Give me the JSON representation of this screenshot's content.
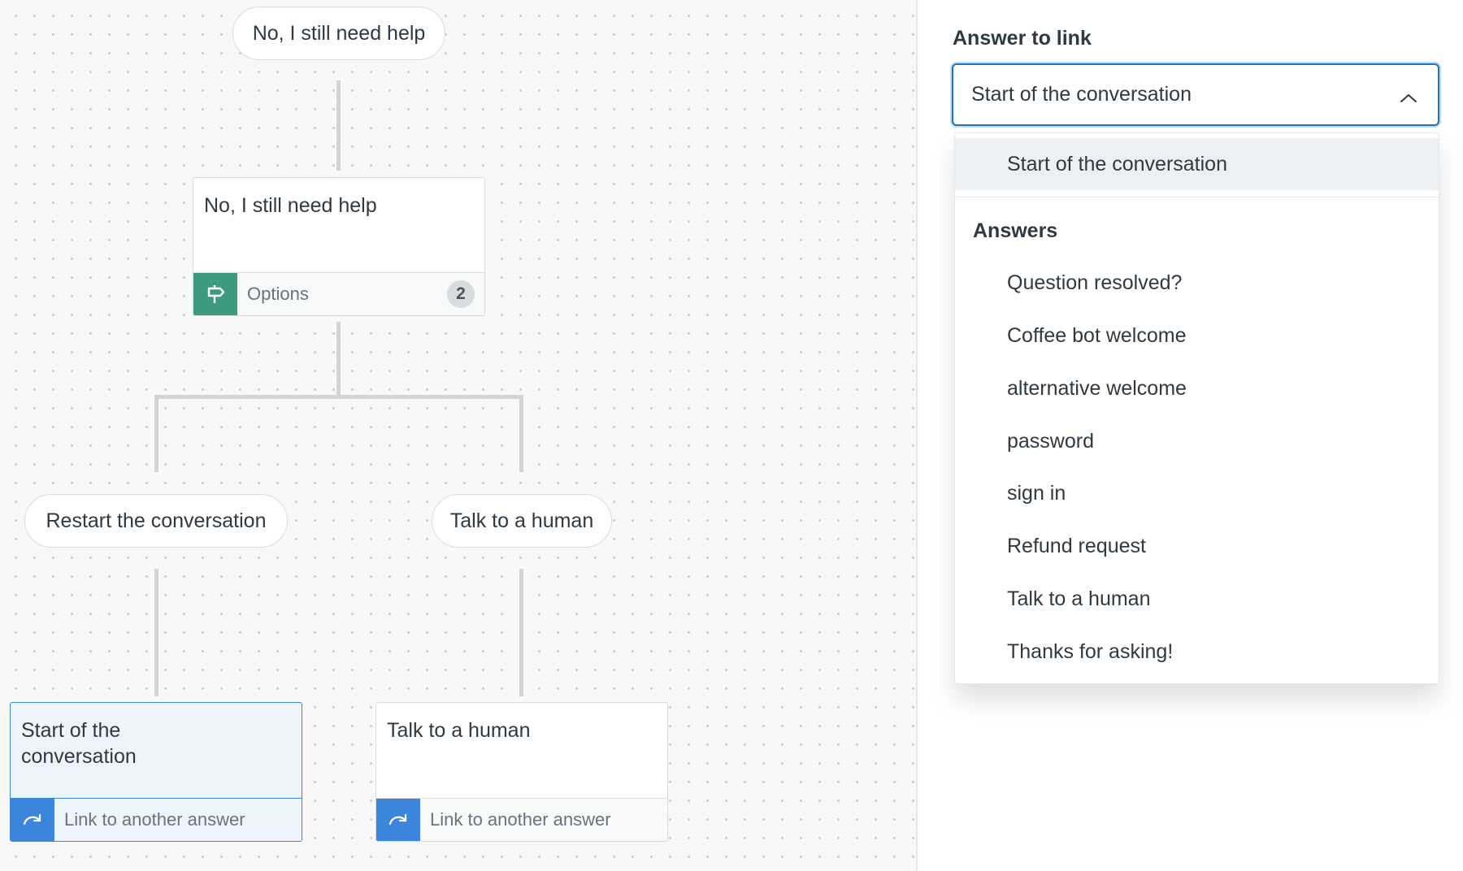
{
  "canvas": {
    "top_option": "No, I still need help",
    "options_card": {
      "title": "No, I still need help",
      "footer_label": "Options",
      "count": "2"
    },
    "branch_left": "Restart the conversation",
    "branch_right": "Talk to a human",
    "link_card_left": {
      "title": "Start of the conversation",
      "footer_label": "Link to another answer"
    },
    "link_card_right": {
      "title": "Talk to a human",
      "footer_label": "Link to another answer"
    }
  },
  "panel": {
    "field_label": "Answer to link",
    "selected_value": "Start of the conversation",
    "dropdown": {
      "start_option": "Start of the conversation",
      "group_label": "Answers",
      "options": [
        "Question resolved?",
        "Coffee bot welcome",
        "alternative welcome",
        "password",
        "sign in",
        "Refund request",
        "Talk to a human",
        "Thanks for asking!"
      ]
    }
  },
  "colors": {
    "accent": "#1f73b7",
    "options_icon": "#3d9a7e",
    "link_icon": "#3b86dc",
    "selected_card": "#edf4fc"
  }
}
